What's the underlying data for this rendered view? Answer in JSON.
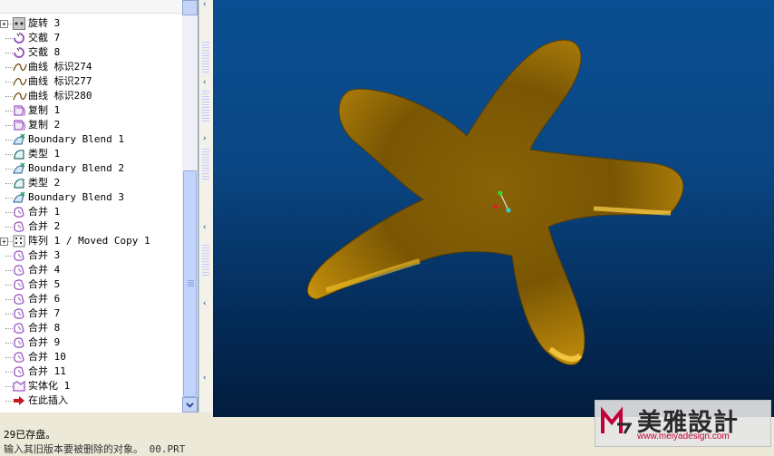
{
  "tree": {
    "items": [
      {
        "label": "旋转 3",
        "icon": "revolve-icon",
        "expand": true
      },
      {
        "label": "交截 7",
        "icon": "intersect-icon"
      },
      {
        "label": "交截 8",
        "icon": "intersect-icon"
      },
      {
        "label": "曲线 标识274",
        "icon": "curve-icon"
      },
      {
        "label": "曲线 标识277",
        "icon": "curve-icon"
      },
      {
        "label": "曲线 标识280",
        "icon": "curve-icon"
      },
      {
        "label": "复制 1",
        "icon": "copy-icon"
      },
      {
        "label": "复制 2",
        "icon": "copy-icon"
      },
      {
        "label": "Boundary Blend 1",
        "icon": "boundary-blend-icon"
      },
      {
        "label": "类型 1",
        "icon": "surface-type-icon"
      },
      {
        "label": "Boundary Blend 2",
        "icon": "boundary-blend-icon"
      },
      {
        "label": "类型 2",
        "icon": "surface-type-icon"
      },
      {
        "label": "Boundary Blend 3",
        "icon": "boundary-blend-icon"
      },
      {
        "label": "合并 1",
        "icon": "merge-icon"
      },
      {
        "label": "合并 2",
        "icon": "merge-icon"
      },
      {
        "label": "阵列 1 / Moved Copy 1",
        "icon": "pattern-icon",
        "expand": true
      },
      {
        "label": "合并 3",
        "icon": "merge-icon"
      },
      {
        "label": "合并 4",
        "icon": "merge-icon"
      },
      {
        "label": "合并 5",
        "icon": "merge-icon"
      },
      {
        "label": "合并 6",
        "icon": "merge-icon"
      },
      {
        "label": "合并 7",
        "icon": "merge-icon"
      },
      {
        "label": "合并 8",
        "icon": "merge-icon"
      },
      {
        "label": "合并 9",
        "icon": "merge-icon"
      },
      {
        "label": "合并 10",
        "icon": "merge-icon"
      },
      {
        "label": "合并 11",
        "icon": "merge-icon"
      },
      {
        "label": "实体化 1",
        "icon": "solidify-icon"
      },
      {
        "label": "在此插入",
        "icon": "insert-here-icon"
      }
    ]
  },
  "messages": {
    "line1": "29已存盘。",
    "line2": "输入其旧版本要被删除的对象。 00.PRT"
  },
  "watermark": {
    "title": "美雅設計",
    "url": "www.meiyadesign.com"
  },
  "colors": {
    "viewport_top": "#0a4f92",
    "viewport_bottom": "#021c3d",
    "model_gold": "#c9920a",
    "tree_icon_purple": "#9c58c0"
  }
}
